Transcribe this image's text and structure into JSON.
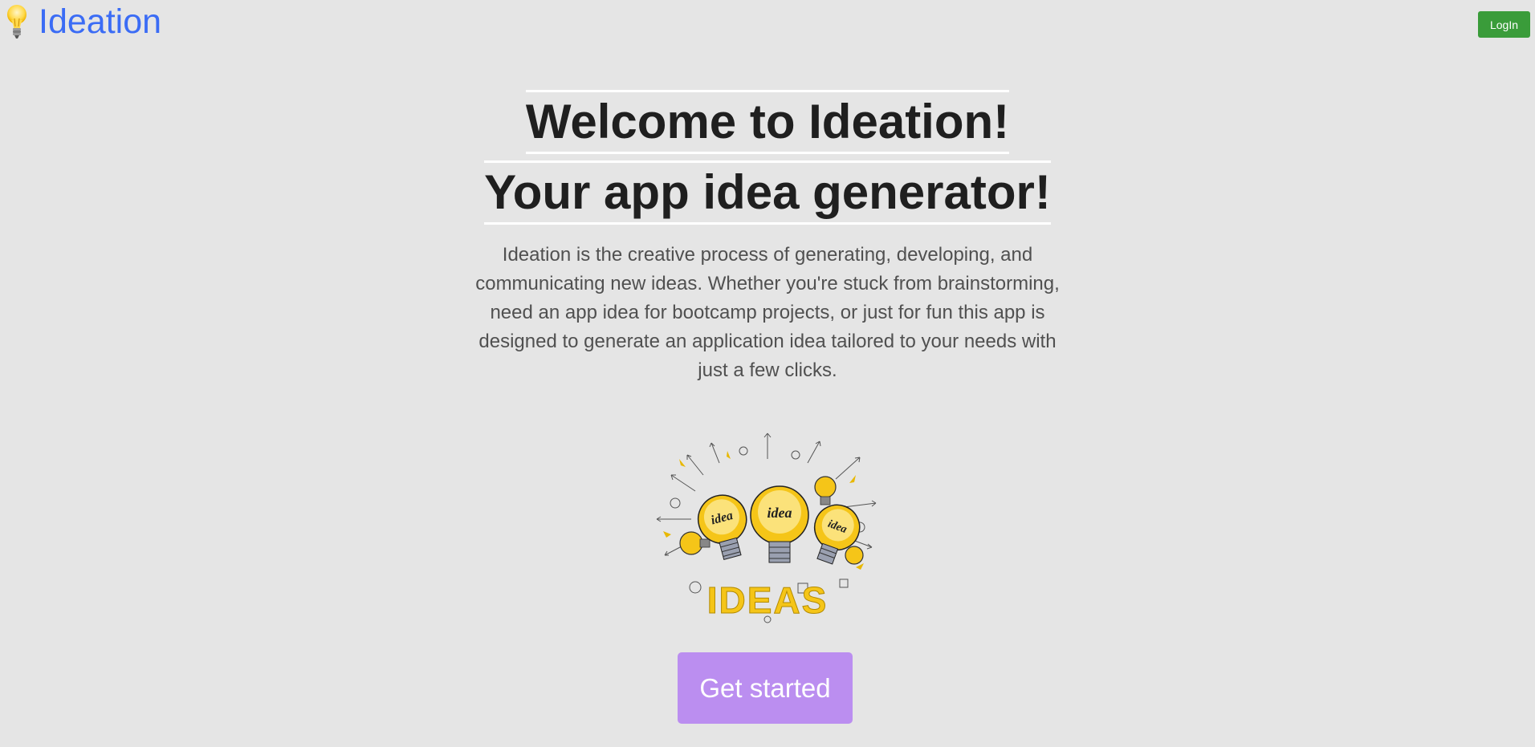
{
  "navbar": {
    "brand_icon": "lightbulb-icon",
    "brand_text": "Ideation",
    "login_label": "LogIn"
  },
  "hero": {
    "title": "Welcome to Ideation!",
    "subtitle": "Your app idea generator!",
    "description": "Ideation is the creative process of generating, developing, and communicating new ideas. Whether you're stuck from brainstorming, need an app idea for bootcamp projects, or just for fun this app is designed to generate an application idea tailored to your needs with just a few clicks.",
    "illustration": {
      "icon": "ideas-lightbulbs-illustration",
      "bulb_labels": [
        "idea",
        "idea",
        "idea"
      ],
      "banner_text": "IDEAS"
    },
    "cta_label": "Get started"
  },
  "colors": {
    "background": "#e5e5e5",
    "brand": "#3b6cf5",
    "login_button": "#3a9c3a",
    "cta_button": "#bb8ef0",
    "heading_text": "#1f1f1f",
    "body_text": "#505050",
    "illustration_yellow": "#f5c518"
  }
}
